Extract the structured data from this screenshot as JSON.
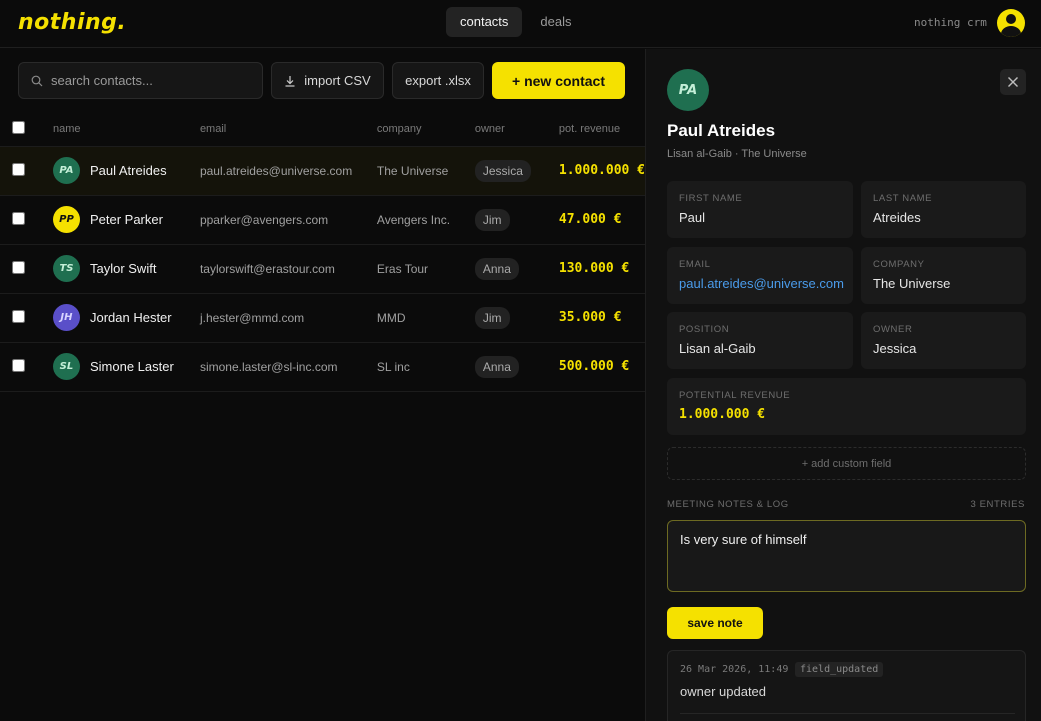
{
  "header": {
    "logo": "nothing.",
    "tabs": [
      {
        "label": "contacts",
        "active": true
      },
      {
        "label": "deals",
        "active": false
      }
    ],
    "brand_name": "nothing crm"
  },
  "toolbar": {
    "search_placeholder": "search contacts...",
    "import_label": "import CSV",
    "export_label": "export .xlsx",
    "new_contact_label": "+ new contact"
  },
  "table": {
    "columns": {
      "name": "name",
      "email": "email",
      "company": "company",
      "owner": "owner",
      "revenue": "pot. revenue"
    },
    "rows": [
      {
        "initials": "PA",
        "name": "Paul Atreides",
        "email": "paul.atreides@universe.com",
        "company": "The Universe",
        "owner": "Jessica",
        "revenue": "1.000.000 €",
        "avatar_bg": "#1f6f50",
        "avatar_fg": "#c4efd8",
        "selected": true
      },
      {
        "initials": "PP",
        "name": "Peter Parker",
        "email": "pparker@avengers.com",
        "company": "Avengers Inc.",
        "owner": "Jim",
        "revenue": "47.000 €",
        "avatar_bg": "#f5e100",
        "avatar_fg": "#111111",
        "selected": false
      },
      {
        "initials": "TS",
        "name": "Taylor Swift",
        "email": "taylorswift@erastour.com",
        "company": "Eras Tour",
        "owner": "Anna",
        "revenue": "130.000 €",
        "avatar_bg": "#1f6f50",
        "avatar_fg": "#c4efd8",
        "selected": false
      },
      {
        "initials": "JH",
        "name": "Jordan Hester",
        "email": "j.hester@mmd.com",
        "company": "MMD",
        "owner": "Jim",
        "revenue": "35.000 €",
        "avatar_bg": "#5a4fc9",
        "avatar_fg": "#d8d3ff",
        "selected": false
      },
      {
        "initials": "SL",
        "name": "Simone Laster",
        "email": "simone.laster@sl-inc.com",
        "company": "SL inc",
        "owner": "Anna",
        "revenue": "500.000 €",
        "avatar_bg": "#1f6f50",
        "avatar_fg": "#c4efd8",
        "selected": false
      }
    ]
  },
  "detail": {
    "initials": "PA",
    "name": "Paul Atreides",
    "subtitle": "Lisan al-Gaib · The Universe",
    "fields": {
      "first_name": {
        "label": "First name",
        "value": "Paul"
      },
      "last_name": {
        "label": "Last name",
        "value": "Atreides"
      },
      "email": {
        "label": "Email",
        "value": "paul.atreides@universe.com"
      },
      "company": {
        "label": "Company",
        "value": "The Universe"
      },
      "position": {
        "label": "Position",
        "value": "Lisan al-Gaib"
      },
      "owner": {
        "label": "Owner",
        "value": "Jessica"
      },
      "potential_revenue": {
        "label": "Potential revenue",
        "value": "1.000.000 €"
      }
    },
    "add_custom_field": "+ add custom field",
    "notes_label": "Meeting notes & log",
    "entries_count": "3 entries",
    "note_draft": "Is very sure of himself",
    "save_note_label": "save note",
    "log": [
      {
        "timestamp": "26 Mar 2026, 11:49",
        "tag": "field_updated",
        "text": "owner updated"
      }
    ]
  },
  "colors": {
    "accent": "#f5e100",
    "background": "#0b0b0b",
    "panel": "#111111",
    "link": "#4a9bea"
  }
}
